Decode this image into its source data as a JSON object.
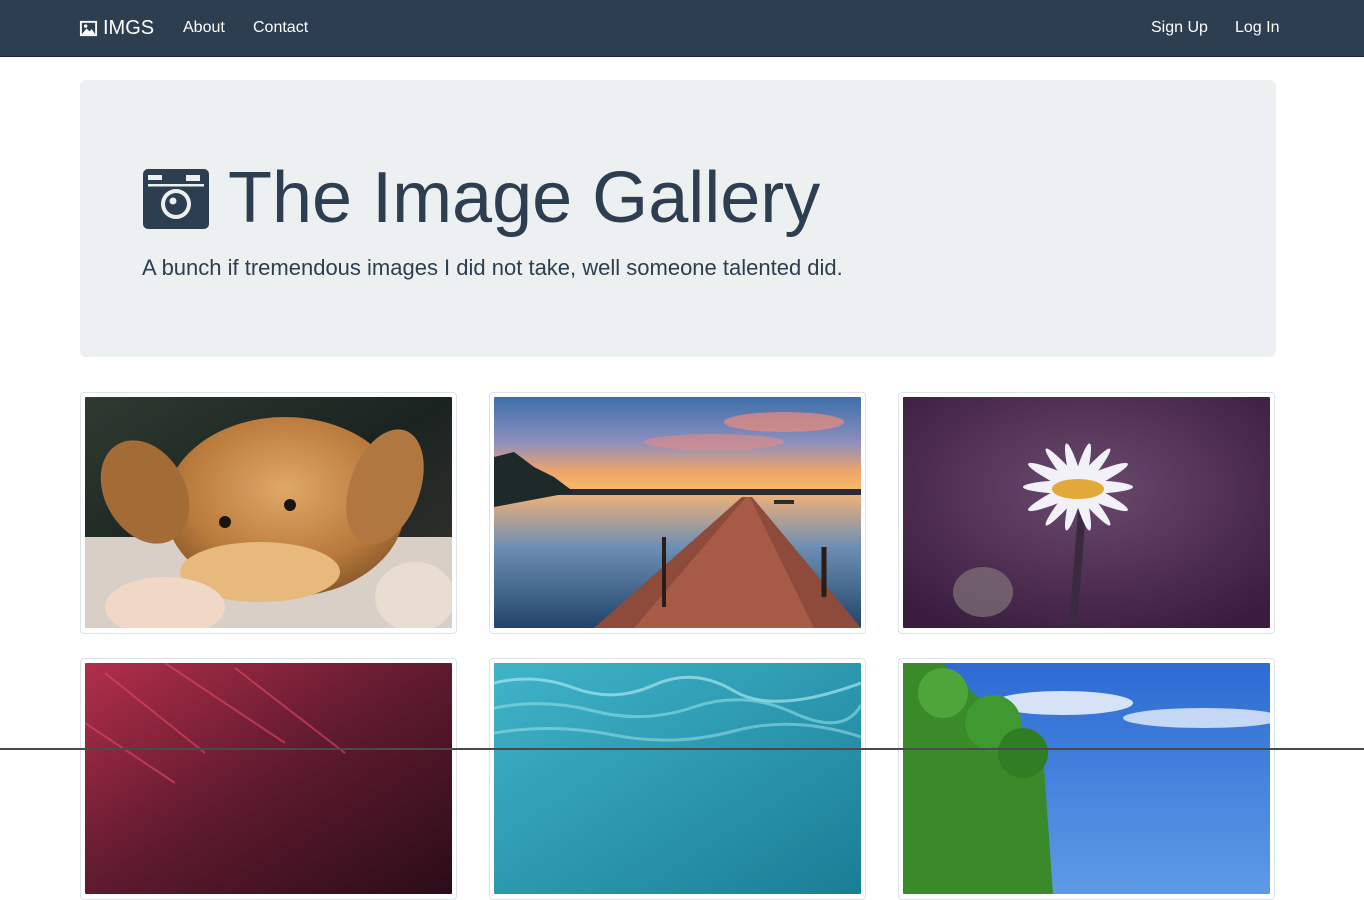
{
  "navbar": {
    "brand": "IMGS",
    "brand_icon": "image-icon",
    "links": [
      {
        "label": "About"
      },
      {
        "label": "Contact"
      }
    ],
    "right_links": [
      {
        "label": "Sign Up"
      },
      {
        "label": "Log In"
      }
    ]
  },
  "hero": {
    "icon": "camera-icon",
    "title": "The Image Gallery",
    "subtitle": "A bunch if tremendous images I did not take, well someone talented did."
  },
  "gallery": {
    "images": [
      {
        "subject": "puppy"
      },
      {
        "subject": "pier-sunset"
      },
      {
        "subject": "daisy"
      },
      {
        "subject": "red-abstract"
      },
      {
        "subject": "water"
      },
      {
        "subject": "trees-sky"
      }
    ]
  },
  "colors": {
    "navbar_bg": "#2c3e50",
    "jumbotron_bg": "#ecf0f1",
    "text_primary": "#2c3e50"
  }
}
